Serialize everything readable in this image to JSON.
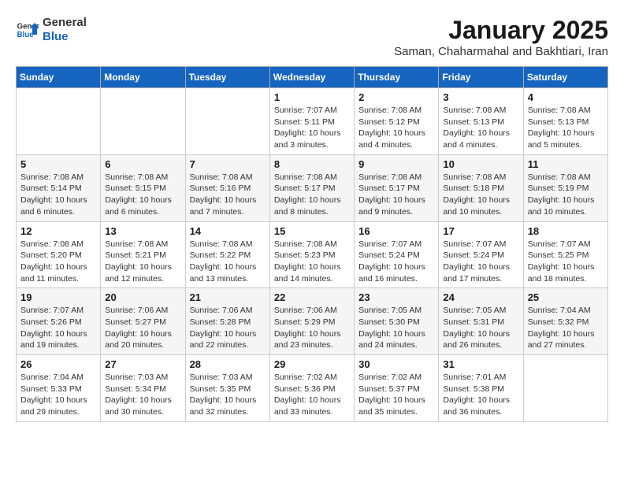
{
  "logo": {
    "line1": "General",
    "line2": "Blue"
  },
  "title": "January 2025",
  "location": "Saman, Chaharmahal and Bakhtiari, Iran",
  "days_of_week": [
    "Sunday",
    "Monday",
    "Tuesday",
    "Wednesday",
    "Thursday",
    "Friday",
    "Saturday"
  ],
  "weeks": [
    [
      {
        "day": "",
        "info": ""
      },
      {
        "day": "",
        "info": ""
      },
      {
        "day": "",
        "info": ""
      },
      {
        "day": "1",
        "sunrise": "7:07 AM",
        "sunset": "5:11 PM",
        "daylight": "10 hours and 3 minutes."
      },
      {
        "day": "2",
        "sunrise": "7:08 AM",
        "sunset": "5:12 PM",
        "daylight": "10 hours and 4 minutes."
      },
      {
        "day": "3",
        "sunrise": "7:08 AM",
        "sunset": "5:13 PM",
        "daylight": "10 hours and 4 minutes."
      },
      {
        "day": "4",
        "sunrise": "7:08 AM",
        "sunset": "5:13 PM",
        "daylight": "10 hours and 5 minutes."
      }
    ],
    [
      {
        "day": "5",
        "sunrise": "7:08 AM",
        "sunset": "5:14 PM",
        "daylight": "10 hours and 6 minutes."
      },
      {
        "day": "6",
        "sunrise": "7:08 AM",
        "sunset": "5:15 PM",
        "daylight": "10 hours and 6 minutes."
      },
      {
        "day": "7",
        "sunrise": "7:08 AM",
        "sunset": "5:16 PM",
        "daylight": "10 hours and 7 minutes."
      },
      {
        "day": "8",
        "sunrise": "7:08 AM",
        "sunset": "5:17 PM",
        "daylight": "10 hours and 8 minutes."
      },
      {
        "day": "9",
        "sunrise": "7:08 AM",
        "sunset": "5:17 PM",
        "daylight": "10 hours and 9 minutes."
      },
      {
        "day": "10",
        "sunrise": "7:08 AM",
        "sunset": "5:18 PM",
        "daylight": "10 hours and 10 minutes."
      },
      {
        "day": "11",
        "sunrise": "7:08 AM",
        "sunset": "5:19 PM",
        "daylight": "10 hours and 10 minutes."
      }
    ],
    [
      {
        "day": "12",
        "sunrise": "7:08 AM",
        "sunset": "5:20 PM",
        "daylight": "10 hours and 11 minutes."
      },
      {
        "day": "13",
        "sunrise": "7:08 AM",
        "sunset": "5:21 PM",
        "daylight": "10 hours and 12 minutes."
      },
      {
        "day": "14",
        "sunrise": "7:08 AM",
        "sunset": "5:22 PM",
        "daylight": "10 hours and 13 minutes."
      },
      {
        "day": "15",
        "sunrise": "7:08 AM",
        "sunset": "5:23 PM",
        "daylight": "10 hours and 14 minutes."
      },
      {
        "day": "16",
        "sunrise": "7:07 AM",
        "sunset": "5:24 PM",
        "daylight": "10 hours and 16 minutes."
      },
      {
        "day": "17",
        "sunrise": "7:07 AM",
        "sunset": "5:24 PM",
        "daylight": "10 hours and 17 minutes."
      },
      {
        "day": "18",
        "sunrise": "7:07 AM",
        "sunset": "5:25 PM",
        "daylight": "10 hours and 18 minutes."
      }
    ],
    [
      {
        "day": "19",
        "sunrise": "7:07 AM",
        "sunset": "5:26 PM",
        "daylight": "10 hours and 19 minutes."
      },
      {
        "day": "20",
        "sunrise": "7:06 AM",
        "sunset": "5:27 PM",
        "daylight": "10 hours and 20 minutes."
      },
      {
        "day": "21",
        "sunrise": "7:06 AM",
        "sunset": "5:28 PM",
        "daylight": "10 hours and 22 minutes."
      },
      {
        "day": "22",
        "sunrise": "7:06 AM",
        "sunset": "5:29 PM",
        "daylight": "10 hours and 23 minutes."
      },
      {
        "day": "23",
        "sunrise": "7:05 AM",
        "sunset": "5:30 PM",
        "daylight": "10 hours and 24 minutes."
      },
      {
        "day": "24",
        "sunrise": "7:05 AM",
        "sunset": "5:31 PM",
        "daylight": "10 hours and 26 minutes."
      },
      {
        "day": "25",
        "sunrise": "7:04 AM",
        "sunset": "5:32 PM",
        "daylight": "10 hours and 27 minutes."
      }
    ],
    [
      {
        "day": "26",
        "sunrise": "7:04 AM",
        "sunset": "5:33 PM",
        "daylight": "10 hours and 29 minutes."
      },
      {
        "day": "27",
        "sunrise": "7:03 AM",
        "sunset": "5:34 PM",
        "daylight": "10 hours and 30 minutes."
      },
      {
        "day": "28",
        "sunrise": "7:03 AM",
        "sunset": "5:35 PM",
        "daylight": "10 hours and 32 minutes."
      },
      {
        "day": "29",
        "sunrise": "7:02 AM",
        "sunset": "5:36 PM",
        "daylight": "10 hours and 33 minutes."
      },
      {
        "day": "30",
        "sunrise": "7:02 AM",
        "sunset": "5:37 PM",
        "daylight": "10 hours and 35 minutes."
      },
      {
        "day": "31",
        "sunrise": "7:01 AM",
        "sunset": "5:38 PM",
        "daylight": "10 hours and 36 minutes."
      },
      {
        "day": "",
        "info": ""
      }
    ]
  ],
  "labels": {
    "sunrise": "Sunrise:",
    "sunset": "Sunset:",
    "daylight": "Daylight:"
  }
}
